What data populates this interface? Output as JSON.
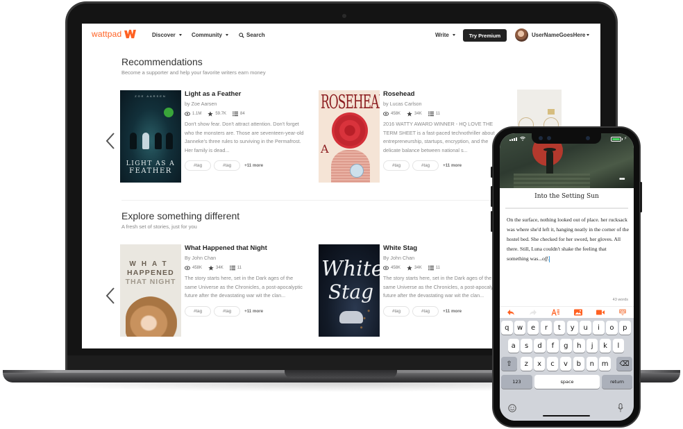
{
  "nav": {
    "logo_text": "wattpad",
    "discover": "Discover",
    "community": "Community",
    "search": "Search",
    "write": "Write",
    "premium": "Try Premium",
    "username": "UserNameGoesHere",
    "brand_color": "#ff6122"
  },
  "sections": [
    {
      "title": "Recommendations",
      "subtitle": "Become a supporter and help your favorite writers earn money",
      "books": [
        {
          "title": "Light as a Feather",
          "author": "by Zoe Aarsen",
          "reads": "1.1M",
          "votes": "59.7K",
          "parts": "84",
          "description": "Don't show fear. Don't attract attention. Don't forget who the monsters are. Those are seventeen-year-old Janneke's three rules to surviving in the Permafrost. Her family is dead...",
          "tags": [
            "#tag",
            "#tag"
          ],
          "more_tags": "+11 more",
          "cover": {
            "author": "ZOE AARSEN",
            "line1": "LIGHT AS A",
            "line2": "FEATHER"
          }
        },
        {
          "title": "Rosehead",
          "author": "by Lucas Carlson",
          "reads": "458K",
          "votes": "34K",
          "parts": "11",
          "description": "2016 WATTY AWARD WINNER - HQ LOVE THE TERM SHEET is a fast-paced technothriller about entrepreneurship, startups, encryption, and the delicate balance between national s...",
          "tags": [
            "#tag",
            "#tag"
          ],
          "more_tags": "+11 more",
          "cover": {
            "title": "ROSEHEAD",
            "a": "A"
          }
        }
      ]
    },
    {
      "title": "Explore something different",
      "subtitle": "A fresh set of stories, just for you",
      "books": [
        {
          "title": "What Happened that Night",
          "author": "By John Chan",
          "reads": "458K",
          "votes": "34K",
          "parts": "11",
          "description": "The story starts here, set in the Dark ages of the same Universe as the Chronicles, a post-apocalyptic future after the devastating war wit the clan...",
          "tags": [
            "#tag",
            "#tag"
          ],
          "more_tags": "+11 more",
          "cover": {
            "line1": "WHAT",
            "line2": "HAPPENED",
            "line3": "THAT NIGHT"
          }
        },
        {
          "title": "White Stag",
          "author": "By John Chan",
          "reads": "458K",
          "votes": "34K",
          "parts": "11",
          "description": "The story starts here, set in the Dark ages of the same Universe as the Chronicles, a post-apocalyptic future after the devastating war wit the clan...",
          "tags": [
            "#tag",
            "#tag"
          ],
          "more_tags": "+11 more",
          "cover": {
            "line1": "White",
            "line2": "Stag"
          }
        }
      ]
    }
  ],
  "phone": {
    "battery_level": 1.0,
    "more_label": "•••",
    "story_title": "Into the Setting Sun",
    "story_text": "On the surface, nothing looked out of place. her rucksack was where she'd left it, hanging neatly in the corner of the hostel bed. She checked for her sword, her gloves. All there. Still, Luna couldn't shake the feeling that something was...",
    "story_text_italic": "off",
    "story_text_end": ".",
    "word_count": "43 words",
    "toolbar_color": "#ff6122",
    "keyboard": {
      "row1": [
        "q",
        "w",
        "e",
        "r",
        "t",
        "y",
        "u",
        "i",
        "o",
        "p"
      ],
      "row2": [
        "a",
        "s",
        "d",
        "f",
        "g",
        "h",
        "j",
        "k",
        "l"
      ],
      "row3": [
        "z",
        "x",
        "c",
        "v",
        "b",
        "n",
        "m"
      ],
      "shift": "⇧",
      "delete": "⌫",
      "numbers": "123",
      "space": "space",
      "return": "return"
    }
  }
}
